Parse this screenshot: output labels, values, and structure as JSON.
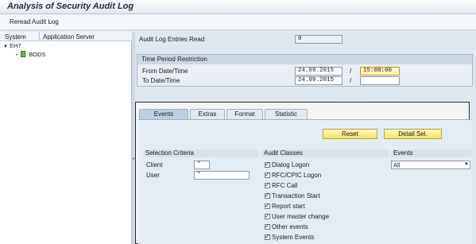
{
  "window": {
    "title": "Analysis of Security Audit Log"
  },
  "toolbar": {
    "reread_label": "Reread Audit Log"
  },
  "tree": {
    "col_system": "System",
    "col_app_server": "Application Server",
    "root": "EH7",
    "child": "BODS"
  },
  "entries": {
    "label": "Audit Log Entries Read",
    "value": "0"
  },
  "time_period": {
    "title": "Time Period Restriction",
    "from_label": "From Date/Time",
    "from_date": "24.09.2015",
    "from_time": "15:00:00",
    "to_label": "To Date/Time",
    "to_date": "24.09.2015",
    "to_time": "",
    "separator": "/"
  },
  "tabs": [
    "Events",
    "Extras",
    "Format",
    "Statistic"
  ],
  "buttons": {
    "reset": "Reset",
    "detail_sel": "Detail Sel."
  },
  "selection_criteria": {
    "title": "Selection Criteria",
    "client_label": "Client",
    "client_value": "*",
    "user_label": "User",
    "user_value": "*"
  },
  "audit_classes": {
    "title": "Audit Classes",
    "items": [
      "Dialog Logon",
      "RFC/CPIC Logon",
      "RFC Call",
      "Transaction Start",
      "Report start",
      "User master change",
      "Other events",
      "System Events"
    ]
  },
  "events": {
    "title": "Events",
    "selected": "All"
  },
  "icons": {
    "tree_toggle": "triangle-down-icon",
    "server": "server-icon",
    "dropdown": "chevron-down-icon"
  }
}
